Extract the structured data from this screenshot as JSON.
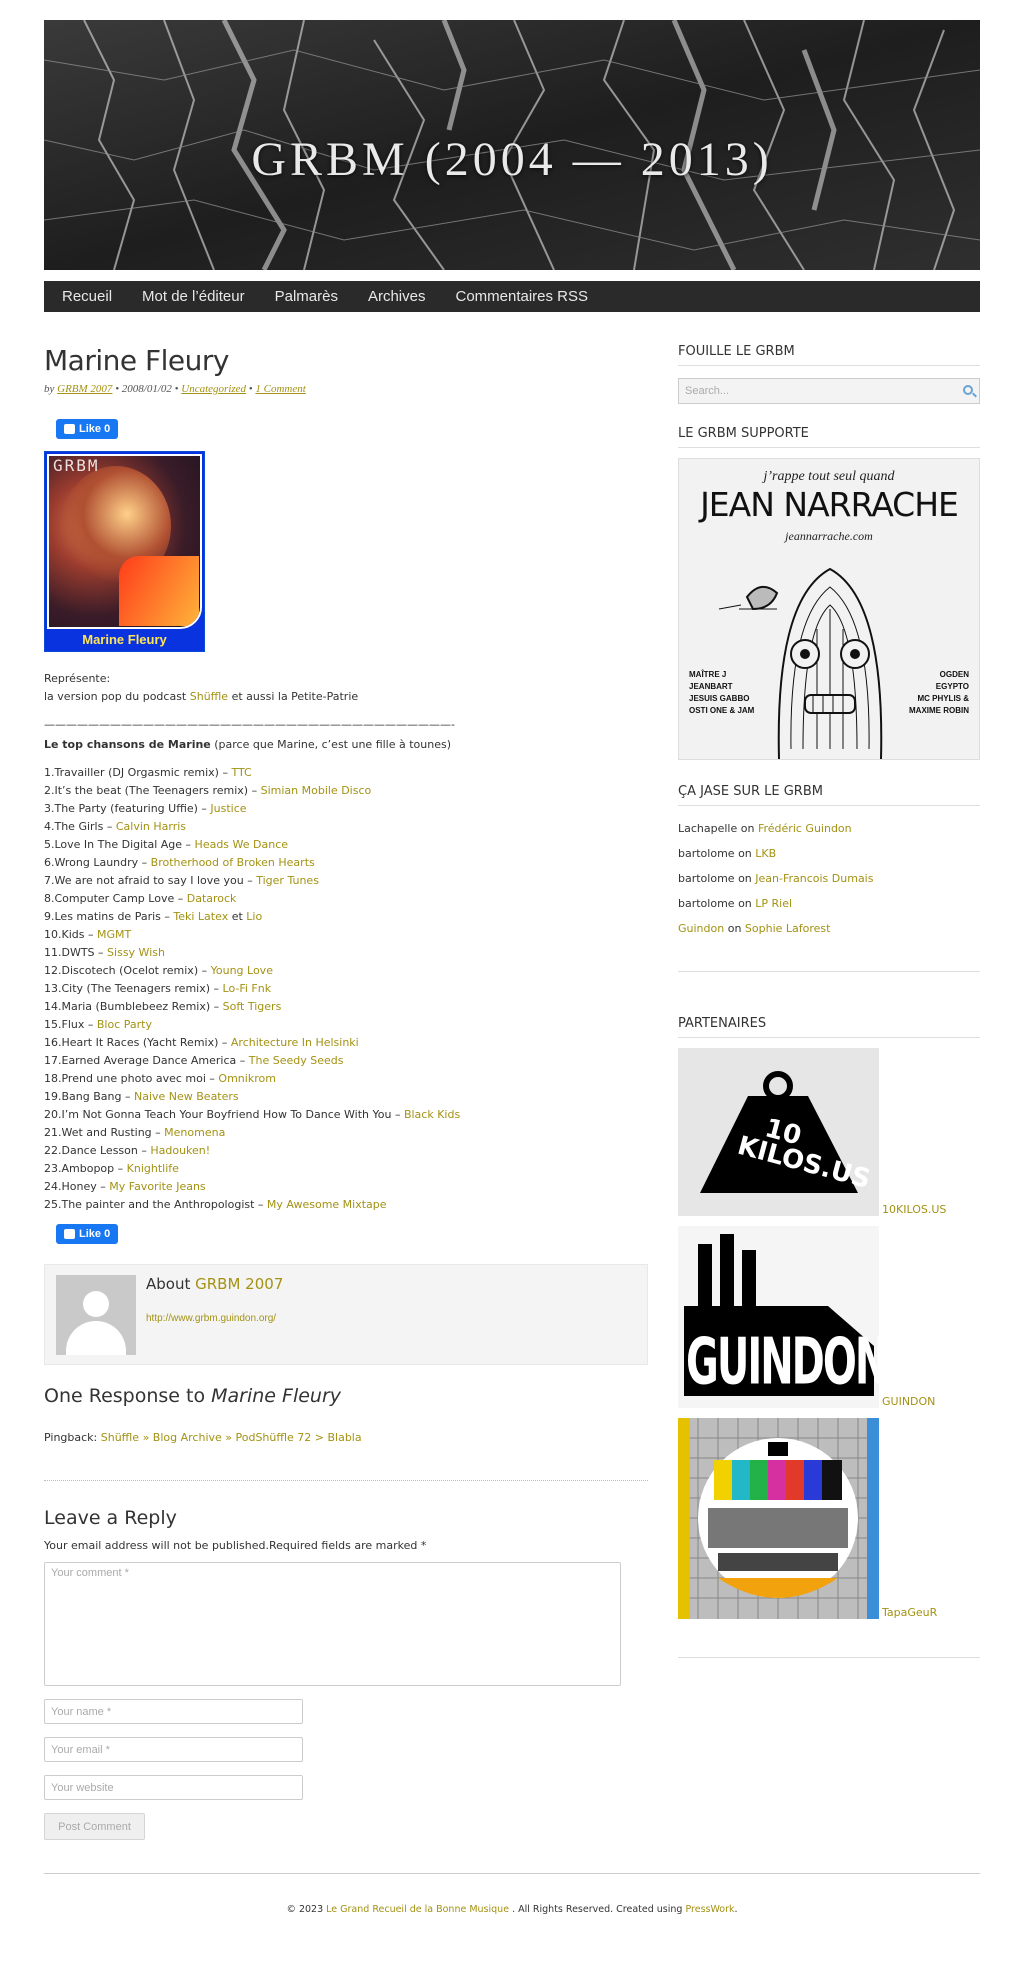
{
  "site": {
    "title": "GRBM (2004 — 2013)"
  },
  "nav": [
    "Recueil",
    "Mot de l’éditeur",
    "Palmarès",
    "Archives",
    "Commentaires RSS"
  ],
  "post": {
    "title": "Marine Fleury",
    "meta": {
      "by": "by",
      "author": "GRBM 2007",
      "sep1": "•",
      "date": "2008/01/02",
      "sep2": "•",
      "category": "Uncategorized",
      "sep3": "•",
      "comments": "1 Comment"
    },
    "like_label": "Like 0",
    "avatar": {
      "logo": "GRBM",
      "name": "Marine Fleury"
    },
    "represente": "Représente:",
    "podcast_prefix": "la version pop du podcast",
    "podcast_link": "Shüffle",
    "podcast_suffix": "et aussi la Petite-Patrie",
    "rule": "—————————————————————————————————————-",
    "top_head_bold": "Le top chansons de Marine",
    "top_head_rest": "(parce que Marine, c’est une fille à tounes)",
    "songs": [
      {
        "text": "1.Travailler (DJ Orgasmic remix) – ",
        "links": [
          "TTC"
        ]
      },
      {
        "text": "2.It’s the beat (The Teenagers remix) – ",
        "links": [
          "Simian Mobile Disco"
        ]
      },
      {
        "text": "3.The Party (featuring Uffie) – ",
        "links": [
          "Justice"
        ]
      },
      {
        "text": "4.The Girls – ",
        "links": [
          "Calvin Harris"
        ]
      },
      {
        "text": "5.Love In The Digital Age – ",
        "links": [
          "Heads We Dance"
        ]
      },
      {
        "text": "6.Wrong Laundry – ",
        "links": [
          "Brotherhood of Broken Hearts"
        ]
      },
      {
        "text": "7.We are not afraid to say I love you – ",
        "links": [
          "Tiger Tunes"
        ]
      },
      {
        "text": "8.Computer Camp Love – ",
        "links": [
          "Datarock"
        ]
      },
      {
        "text": "9.Les matins de Paris – ",
        "links": [
          "Teki Latex",
          "Lio"
        ],
        "joiner": " et "
      },
      {
        "text": "10.Kids – ",
        "links": [
          "MGMT"
        ]
      },
      {
        "text": "11.DWTS – ",
        "links": [
          "Sissy Wish"
        ]
      },
      {
        "text": "12.Discotech (Ocelot remix) – ",
        "links": [
          "Young Love"
        ]
      },
      {
        "text": "13.City (The Teenagers remix) – ",
        "links": [
          "Lo-Fi Fnk"
        ]
      },
      {
        "text": "14.Maria (Bumblebeez Remix) – ",
        "links": [
          "Soft Tigers"
        ]
      },
      {
        "text": "15.Flux – ",
        "links": [
          "Bloc Party"
        ]
      },
      {
        "text": "16.Heart It Races (Yacht Remix) – ",
        "links": [
          "Architecture In Helsinki"
        ]
      },
      {
        "text": "17.Earned Average Dance America – ",
        "links": [
          "The Seedy Seeds"
        ]
      },
      {
        "text": "18.Prend une photo avec moi – ",
        "links": [
          "Omnikrom"
        ]
      },
      {
        "text": "19.Bang Bang – ",
        "links": [
          "Naive New Beaters"
        ]
      },
      {
        "text": "20.I’m Not Gonna Teach Your Boyfriend How To Dance With You – ",
        "links": [
          "Black Kids"
        ]
      },
      {
        "text": "21.Wet and Rusting – ",
        "links": [
          "Menomena"
        ]
      },
      {
        "text": "22.Dance Lesson – ",
        "links": [
          "Hadouken!"
        ]
      },
      {
        "text": "23.Ambopop – ",
        "links": [
          "Knightlife"
        ]
      },
      {
        "text": "24.Honey – ",
        "links": [
          "My Favorite Jeans"
        ]
      },
      {
        "text": "25.The painter and the Anthropologist – ",
        "links": [
          "My Awesome Mixtape"
        ]
      }
    ],
    "author_box": {
      "about": "About",
      "name": "GRBM 2007",
      "url": "http://www.grbm.guindon.org/"
    },
    "responses": {
      "prefix": "One Response to",
      "title": "Marine Fleury"
    },
    "pingback": {
      "label": "Pingback:",
      "link": "Shüffle » Blog Archive » PodShüffle 72 > Blabla"
    }
  },
  "reply": {
    "title": "Leave a Reply",
    "notes": "Your email address will not be published.Required fields are marked *",
    "comment_placeholder": "Your comment *",
    "name_placeholder": "Your name *",
    "email_placeholder": "Your email *",
    "website_placeholder": "Your website",
    "submit_label": "Post Comment"
  },
  "sidebar": {
    "search_title": "FOUILLE LE GRBM",
    "search_placeholder": "Search...",
    "support_title": "LE GRBM SUPPORTE",
    "support_ad": {
      "line1": "j’rappe tout seul quand",
      "line2": "JEAN NARRACHE",
      "line3": "jeannarrache.com",
      "left": [
        "MAÎTRE J",
        "JEANBART",
        "JESUIS GABBO",
        "OSTI ONE & JAM"
      ],
      "right": [
        "OGDEN",
        "EGYPTO",
        "MC PHYLIS &",
        "MAXIME ROBIN"
      ]
    },
    "comments_title": "ÇA JASE SUR LE GRBM",
    "recent_comments": [
      {
        "author": "Lachapelle",
        "author_is_link": false,
        "on": "on",
        "post": "Frédéric Guindon"
      },
      {
        "author": "bartolome",
        "author_is_link": false,
        "on": "on",
        "post": "LKB"
      },
      {
        "author": "bartolome",
        "author_is_link": false,
        "on": "on",
        "post": "Jean-Francois Dumais"
      },
      {
        "author": "bartolome",
        "author_is_link": false,
        "on": "on",
        "post": "LP Riel"
      },
      {
        "author": "Guindon",
        "author_is_link": true,
        "on": "on",
        "post": "Sophie Laforest"
      }
    ],
    "partners_title": "PARTENAIRES",
    "partners": [
      {
        "name": "10KILOS.US",
        "art_text": "10\nKILOS.US",
        "icon": "weight-logo"
      },
      {
        "name": "GUINDON",
        "art_text": "GUINDON",
        "icon": "factory-logo"
      },
      {
        "name": "TapaGeuR",
        "art_text": "",
        "icon": "test-card-logo"
      }
    ]
  },
  "footer": {
    "copy": "© 2023",
    "site_link": "Le Grand Recueil de la Bonne Musique",
    "rights": ". All Rights Reserved. Created using",
    "theme_link": "PressWork",
    "end": "."
  },
  "colors": {
    "link": "#a39213",
    "nav_bg": "#2a2a2a",
    "fb_blue": "#1877f2"
  }
}
